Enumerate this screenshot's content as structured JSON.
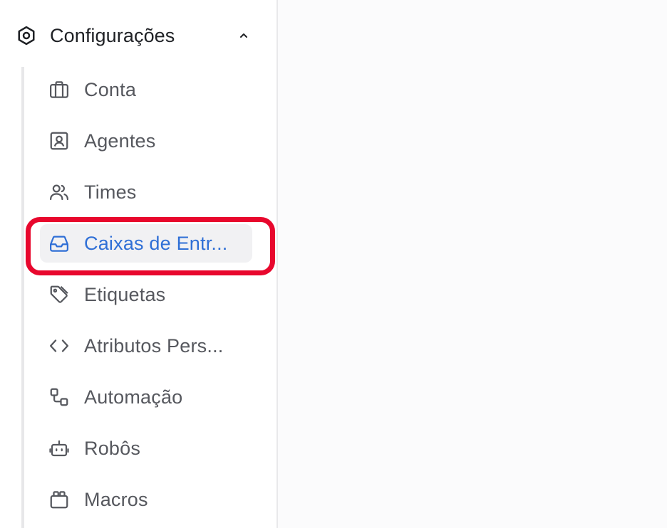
{
  "sidebar": {
    "group": {
      "title": "Configurações",
      "expanded": true,
      "icon": "settings-hexagon-icon"
    },
    "items": [
      {
        "label": "Conta",
        "icon": "briefcase-icon",
        "active": false
      },
      {
        "label": "Agentes",
        "icon": "user-portrait-icon",
        "active": false
      },
      {
        "label": "Times",
        "icon": "users-icon",
        "active": false
      },
      {
        "label": "Caixas de Entr...",
        "icon": "inbox-icon",
        "active": true
      },
      {
        "label": "Etiquetas",
        "icon": "tag-icon",
        "active": false
      },
      {
        "label": "Atributos Pers...",
        "icon": "code-icon",
        "active": false
      },
      {
        "label": "Automação",
        "icon": "automation-flow-icon",
        "active": false
      },
      {
        "label": "Robôs",
        "icon": "bot-icon",
        "active": false
      },
      {
        "label": "Macros",
        "icon": "macros-icon",
        "active": false
      }
    ]
  },
  "colors": {
    "accent": "#2f6fd6",
    "highlight": "#e8072d",
    "text": "#56585e",
    "heading": "#1f2125"
  }
}
